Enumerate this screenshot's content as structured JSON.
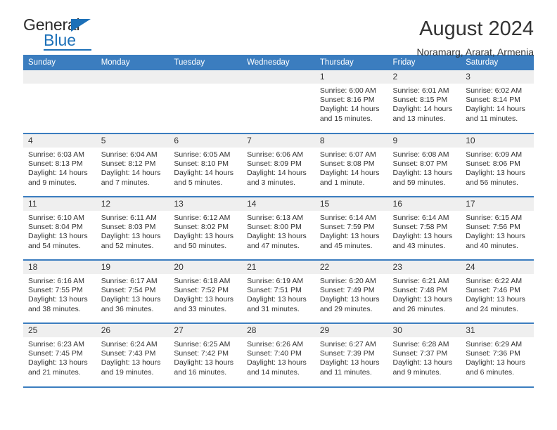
{
  "brand": {
    "name_part1": "General",
    "name_part2": "Blue",
    "accent_color": "#1c70b8"
  },
  "header": {
    "title": "August 2024",
    "subtitle": "Noramarg, Ararat, Armenia"
  },
  "theme": {
    "header_blue": "#3b7dbf",
    "daynum_bg": "#efefef",
    "text": "#333333"
  },
  "weekdays": [
    "Sunday",
    "Monday",
    "Tuesday",
    "Wednesday",
    "Thursday",
    "Friday",
    "Saturday"
  ],
  "weeks": [
    [
      {
        "day": "",
        "lines": []
      },
      {
        "day": "",
        "lines": []
      },
      {
        "day": "",
        "lines": []
      },
      {
        "day": "",
        "lines": []
      },
      {
        "day": "1",
        "lines": [
          "Sunrise: 6:00 AM",
          "Sunset: 8:16 PM",
          "Daylight: 14 hours",
          "and 15 minutes."
        ]
      },
      {
        "day": "2",
        "lines": [
          "Sunrise: 6:01 AM",
          "Sunset: 8:15 PM",
          "Daylight: 14 hours",
          "and 13 minutes."
        ]
      },
      {
        "day": "3",
        "lines": [
          "Sunrise: 6:02 AM",
          "Sunset: 8:14 PM",
          "Daylight: 14 hours",
          "and 11 minutes."
        ]
      }
    ],
    [
      {
        "day": "4",
        "lines": [
          "Sunrise: 6:03 AM",
          "Sunset: 8:13 PM",
          "Daylight: 14 hours",
          "and 9 minutes."
        ]
      },
      {
        "day": "5",
        "lines": [
          "Sunrise: 6:04 AM",
          "Sunset: 8:12 PM",
          "Daylight: 14 hours",
          "and 7 minutes."
        ]
      },
      {
        "day": "6",
        "lines": [
          "Sunrise: 6:05 AM",
          "Sunset: 8:10 PM",
          "Daylight: 14 hours",
          "and 5 minutes."
        ]
      },
      {
        "day": "7",
        "lines": [
          "Sunrise: 6:06 AM",
          "Sunset: 8:09 PM",
          "Daylight: 14 hours",
          "and 3 minutes."
        ]
      },
      {
        "day": "8",
        "lines": [
          "Sunrise: 6:07 AM",
          "Sunset: 8:08 PM",
          "Daylight: 14 hours",
          "and 1 minute."
        ]
      },
      {
        "day": "9",
        "lines": [
          "Sunrise: 6:08 AM",
          "Sunset: 8:07 PM",
          "Daylight: 13 hours",
          "and 59 minutes."
        ]
      },
      {
        "day": "10",
        "lines": [
          "Sunrise: 6:09 AM",
          "Sunset: 8:06 PM",
          "Daylight: 13 hours",
          "and 56 minutes."
        ]
      }
    ],
    [
      {
        "day": "11",
        "lines": [
          "Sunrise: 6:10 AM",
          "Sunset: 8:04 PM",
          "Daylight: 13 hours",
          "and 54 minutes."
        ]
      },
      {
        "day": "12",
        "lines": [
          "Sunrise: 6:11 AM",
          "Sunset: 8:03 PM",
          "Daylight: 13 hours",
          "and 52 minutes."
        ]
      },
      {
        "day": "13",
        "lines": [
          "Sunrise: 6:12 AM",
          "Sunset: 8:02 PM",
          "Daylight: 13 hours",
          "and 50 minutes."
        ]
      },
      {
        "day": "14",
        "lines": [
          "Sunrise: 6:13 AM",
          "Sunset: 8:00 PM",
          "Daylight: 13 hours",
          "and 47 minutes."
        ]
      },
      {
        "day": "15",
        "lines": [
          "Sunrise: 6:14 AM",
          "Sunset: 7:59 PM",
          "Daylight: 13 hours",
          "and 45 minutes."
        ]
      },
      {
        "day": "16",
        "lines": [
          "Sunrise: 6:14 AM",
          "Sunset: 7:58 PM",
          "Daylight: 13 hours",
          "and 43 minutes."
        ]
      },
      {
        "day": "17",
        "lines": [
          "Sunrise: 6:15 AM",
          "Sunset: 7:56 PM",
          "Daylight: 13 hours",
          "and 40 minutes."
        ]
      }
    ],
    [
      {
        "day": "18",
        "lines": [
          "Sunrise: 6:16 AM",
          "Sunset: 7:55 PM",
          "Daylight: 13 hours",
          "and 38 minutes."
        ]
      },
      {
        "day": "19",
        "lines": [
          "Sunrise: 6:17 AM",
          "Sunset: 7:54 PM",
          "Daylight: 13 hours",
          "and 36 minutes."
        ]
      },
      {
        "day": "20",
        "lines": [
          "Sunrise: 6:18 AM",
          "Sunset: 7:52 PM",
          "Daylight: 13 hours",
          "and 33 minutes."
        ]
      },
      {
        "day": "21",
        "lines": [
          "Sunrise: 6:19 AM",
          "Sunset: 7:51 PM",
          "Daylight: 13 hours",
          "and 31 minutes."
        ]
      },
      {
        "day": "22",
        "lines": [
          "Sunrise: 6:20 AM",
          "Sunset: 7:49 PM",
          "Daylight: 13 hours",
          "and 29 minutes."
        ]
      },
      {
        "day": "23",
        "lines": [
          "Sunrise: 6:21 AM",
          "Sunset: 7:48 PM",
          "Daylight: 13 hours",
          "and 26 minutes."
        ]
      },
      {
        "day": "24",
        "lines": [
          "Sunrise: 6:22 AM",
          "Sunset: 7:46 PM",
          "Daylight: 13 hours",
          "and 24 minutes."
        ]
      }
    ],
    [
      {
        "day": "25",
        "lines": [
          "Sunrise: 6:23 AM",
          "Sunset: 7:45 PM",
          "Daylight: 13 hours",
          "and 21 minutes."
        ]
      },
      {
        "day": "26",
        "lines": [
          "Sunrise: 6:24 AM",
          "Sunset: 7:43 PM",
          "Daylight: 13 hours",
          "and 19 minutes."
        ]
      },
      {
        "day": "27",
        "lines": [
          "Sunrise: 6:25 AM",
          "Sunset: 7:42 PM",
          "Daylight: 13 hours",
          "and 16 minutes."
        ]
      },
      {
        "day": "28",
        "lines": [
          "Sunrise: 6:26 AM",
          "Sunset: 7:40 PM",
          "Daylight: 13 hours",
          "and 14 minutes."
        ]
      },
      {
        "day": "29",
        "lines": [
          "Sunrise: 6:27 AM",
          "Sunset: 7:39 PM",
          "Daylight: 13 hours",
          "and 11 minutes."
        ]
      },
      {
        "day": "30",
        "lines": [
          "Sunrise: 6:28 AM",
          "Sunset: 7:37 PM",
          "Daylight: 13 hours",
          "and 9 minutes."
        ]
      },
      {
        "day": "31",
        "lines": [
          "Sunrise: 6:29 AM",
          "Sunset: 7:36 PM",
          "Daylight: 13 hours",
          "and 6 minutes."
        ]
      }
    ]
  ]
}
